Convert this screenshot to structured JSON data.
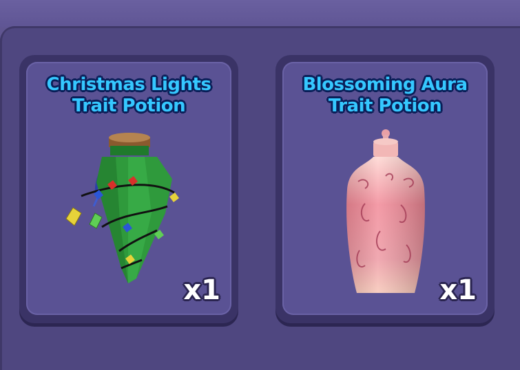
{
  "inventory": {
    "items": [
      {
        "title_line1": "Christmas Lights",
        "title_line2": "Trait Potion",
        "quantity": "x1",
        "icon": "christmas-lights-potion-icon",
        "accent_color": "#2f9a3c"
      },
      {
        "title_line1": "Blossoming Aura",
        "title_line2": "Trait Potion",
        "quantity": "x1",
        "icon": "blossoming-aura-potion-icon",
        "accent_color": "#f28a98"
      }
    ]
  },
  "colors": {
    "background": "#5f5590",
    "card": "#5a5294",
    "title_text": "#35c8ff",
    "title_outline": "#0b1f58"
  }
}
